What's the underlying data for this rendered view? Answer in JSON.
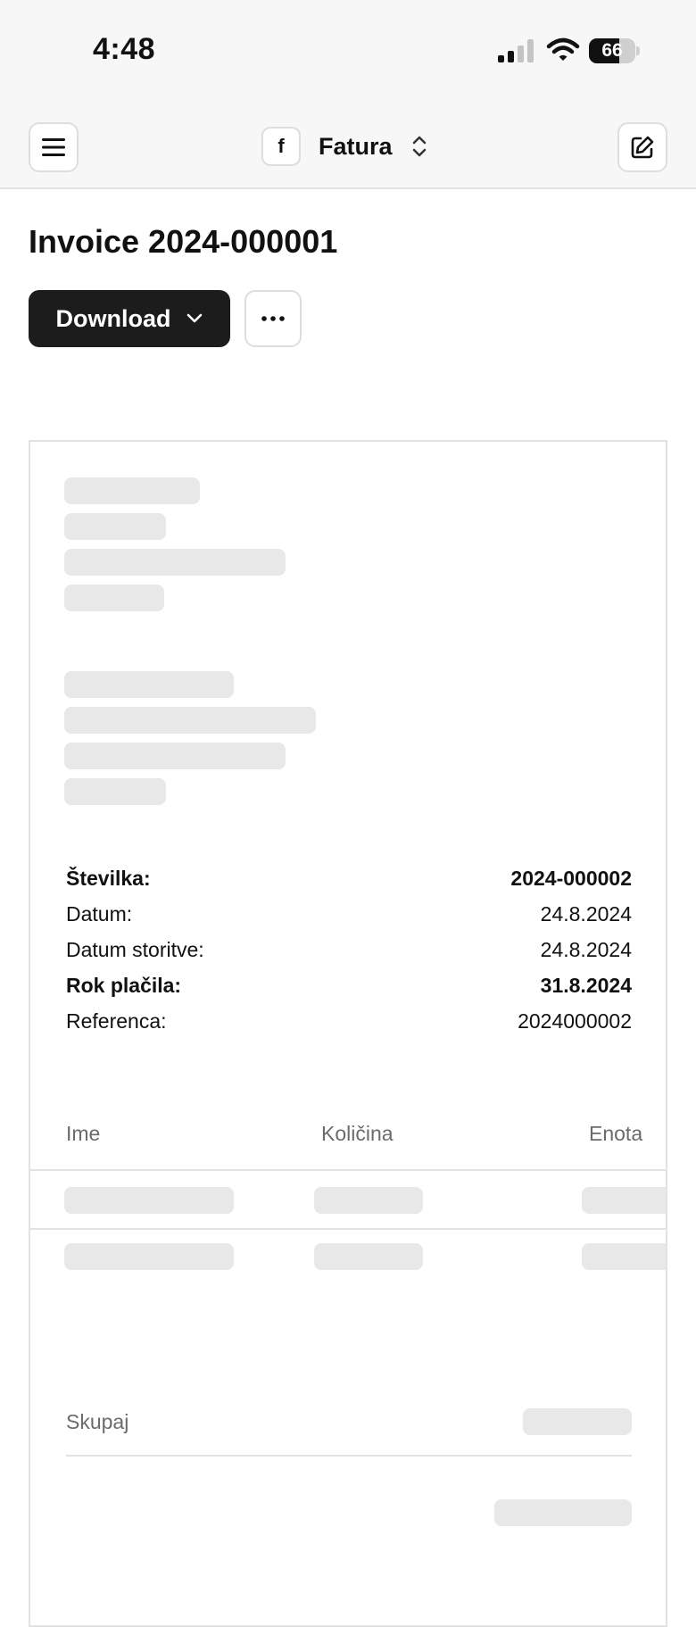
{
  "status_bar": {
    "time": "4:48",
    "battery_percent": "66",
    "battery_level": 0.66
  },
  "navbar": {
    "org_initial": "f",
    "org_name": "Fatura"
  },
  "page": {
    "title": "Invoice 2024-000001",
    "download_label": "Download"
  },
  "invoice": {
    "meta": [
      {
        "label": "Številka:",
        "value": "2024-000002"
      },
      {
        "label": "Datum:",
        "value": "24.8.2024"
      },
      {
        "label": "Datum storitve:",
        "value": "24.8.2024"
      },
      {
        "label": "Rok plačila:",
        "value": "31.8.2024"
      },
      {
        "label": "Referenca:",
        "value": "2024000002"
      }
    ],
    "columns": [
      "Ime",
      "Količina",
      "Enota"
    ],
    "total_label": "Skupaj"
  },
  "colors": {
    "primary_button": "#1c1c1c",
    "skeleton": "#e8e8e8",
    "border": "#e2e2e2"
  }
}
